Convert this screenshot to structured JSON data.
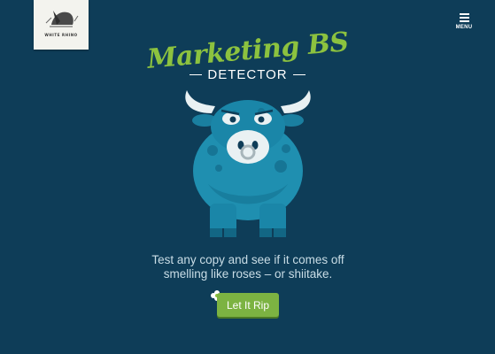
{
  "brand": {
    "logo_text": "WHITE RHINO"
  },
  "header": {
    "menu_label": "MENU",
    "menu_icon": "hamburger-icon"
  },
  "hero": {
    "title_script": "Marketing BS",
    "subtitle": "DETECTOR",
    "tagline_line1": "Test any copy and see if it comes off",
    "tagline_line2": "smelling like roses – or shiitake."
  },
  "cta": {
    "label": "Let It Rip",
    "icon": "flower-icon"
  },
  "colors": {
    "background": "#0e3d58",
    "accent_green": "#8cc23f",
    "bull_blue": "#1f8fb0",
    "button_green": "#7cb342"
  }
}
